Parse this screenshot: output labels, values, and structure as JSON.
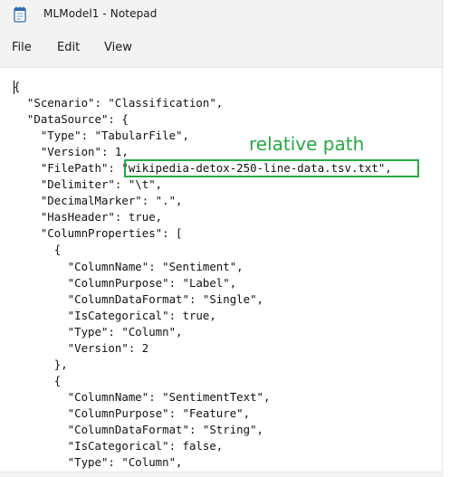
{
  "window": {
    "title": "MLModel1 - Notepad",
    "app_icon": "notepad-icon"
  },
  "menu": {
    "items": [
      "File",
      "Edit",
      "View"
    ]
  },
  "editor": {
    "lines": [
      "{",
      "  \"Scenario\": \"Classification\",",
      "  \"DataSource\": {",
      "    \"Type\": \"TabularFile\",",
      "    \"Version\": 1,",
      "    \"FilePath\": \"wikipedia-detox-250-line-data.tsv.txt\",",
      "    \"Delimiter\": \"\\t\",",
      "    \"DecimalMarker\": \".\",",
      "    \"HasHeader\": true,",
      "    \"ColumnProperties\": [",
      "      {",
      "        \"ColumnName\": \"Sentiment\",",
      "        \"ColumnPurpose\": \"Label\",",
      "        \"ColumnDataFormat\": \"Single\",",
      "        \"IsCategorical\": true,",
      "        \"Type\": \"Column\",",
      "        \"Version\": 2",
      "      },",
      "      {",
      "        \"ColumnName\": \"SentimentText\",",
      "        \"ColumnPurpose\": \"Feature\",",
      "        \"ColumnDataFormat\": \"String\",",
      "        \"IsCategorical\": false,",
      "        \"Type\": \"Column\","
    ]
  },
  "annotation": {
    "text": "relative path",
    "color": "#27a844"
  }
}
